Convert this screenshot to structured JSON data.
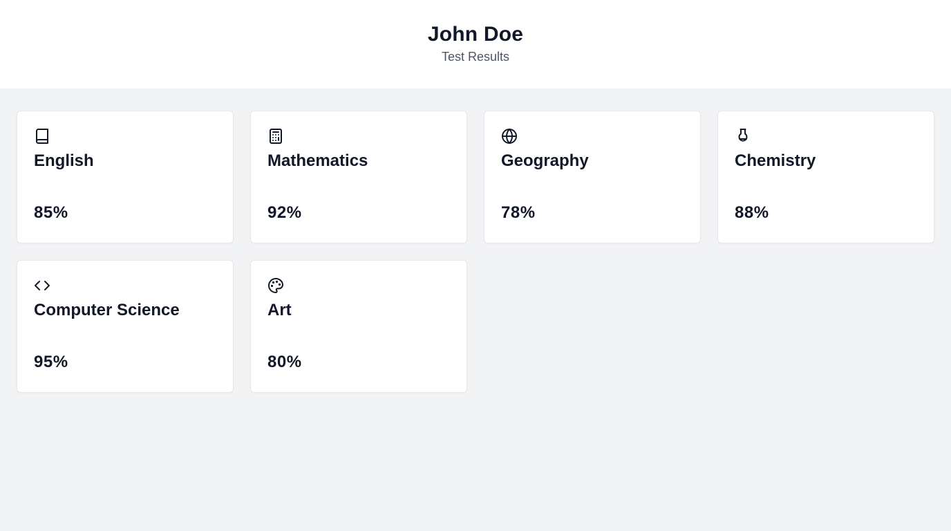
{
  "header": {
    "name": "John Doe",
    "subtitle": "Test Results"
  },
  "subjects": [
    {
      "label": "English",
      "score": "85%",
      "icon": "book-icon"
    },
    {
      "label": "Mathematics",
      "score": "92%",
      "icon": "calculator-icon"
    },
    {
      "label": "Geography",
      "score": "78%",
      "icon": "globe-icon"
    },
    {
      "label": "Chemistry",
      "score": "88%",
      "icon": "flask-icon"
    },
    {
      "label": "Computer Science",
      "score": "95%",
      "icon": "code-icon"
    },
    {
      "label": "Art",
      "score": "80%",
      "icon": "palette-icon"
    }
  ],
  "colors": {
    "page_background": "#f2f3f5",
    "card_background": "#ffffff",
    "text_primary": "#111827",
    "text_secondary": "#4b5563"
  }
}
